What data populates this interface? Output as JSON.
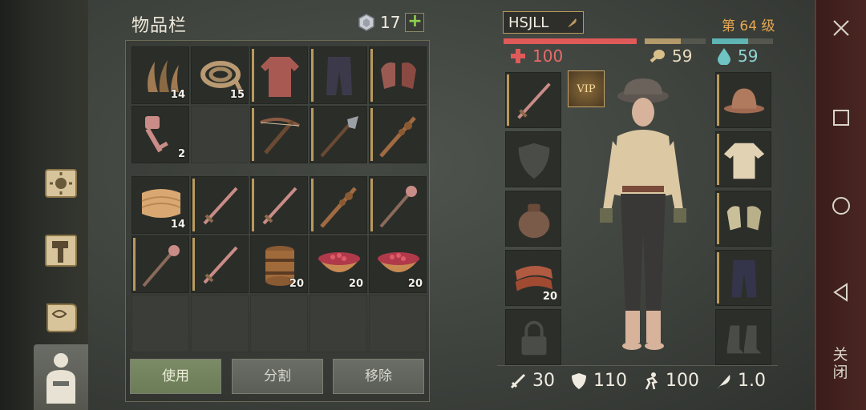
{
  "inventory": {
    "title": "物品栏",
    "coin_count": "17",
    "plus_label": "+",
    "slots": [
      {
        "icon": "herb-icon",
        "count": "14",
        "bar": false
      },
      {
        "icon": "rope-icon",
        "count": "15",
        "bar": false
      },
      {
        "icon": "chainmail-shirt-icon",
        "count": "",
        "bar": true
      },
      {
        "icon": "pants-icon",
        "count": "",
        "bar": true
      },
      {
        "icon": "chainmail-gloves-icon",
        "count": "",
        "bar": true
      },
      {
        "icon": "key-icon",
        "count": "2",
        "bar": false
      },
      {
        "icon": "empty",
        "count": "",
        "bar": false
      },
      {
        "icon": "crossbow-icon",
        "count": "",
        "bar": true
      },
      {
        "icon": "halberd-icon",
        "count": "",
        "bar": true
      },
      {
        "icon": "spiked-club-icon",
        "count": "",
        "bar": true
      },
      {
        "icon": "cloth-icon",
        "count": "14",
        "bar": false
      },
      {
        "icon": "sword-icon",
        "count": "",
        "bar": true
      },
      {
        "icon": "sword-icon",
        "count": "",
        "bar": true
      },
      {
        "icon": "spiked-club-icon",
        "count": "",
        "bar": true
      },
      {
        "icon": "mace-icon",
        "count": "",
        "bar": true
      },
      {
        "icon": "mace-icon",
        "count": "",
        "bar": true
      },
      {
        "icon": "sword-icon",
        "count": "",
        "bar": true
      },
      {
        "icon": "barrel-icon",
        "count": "20",
        "bar": false
      },
      {
        "icon": "berry-bowl-icon",
        "count": "20",
        "bar": false
      },
      {
        "icon": "berry-bowl-icon",
        "count": "20",
        "bar": false
      }
    ],
    "buttons": {
      "use": "使用",
      "split": "分割",
      "remove": "移除"
    }
  },
  "character": {
    "name": "HSJLL",
    "level": "第 64 级",
    "health": "100",
    "hunger": "59",
    "thirst": "59",
    "health_fill": 1.0,
    "hunger_fill": 0.59,
    "thirst_fill": 0.59,
    "vip_label": "VIP",
    "bag_count": "20",
    "attack": "30",
    "armor": "110",
    "speed": "100",
    "weight": "1.0"
  },
  "colors": {
    "health": "#e05a5a",
    "hunger": "#b39a6a",
    "thirst": "#5fb4b4",
    "level": "#e7a752",
    "accent_bar": "#b99a5c"
  },
  "system": {
    "close_label": "关闭"
  }
}
